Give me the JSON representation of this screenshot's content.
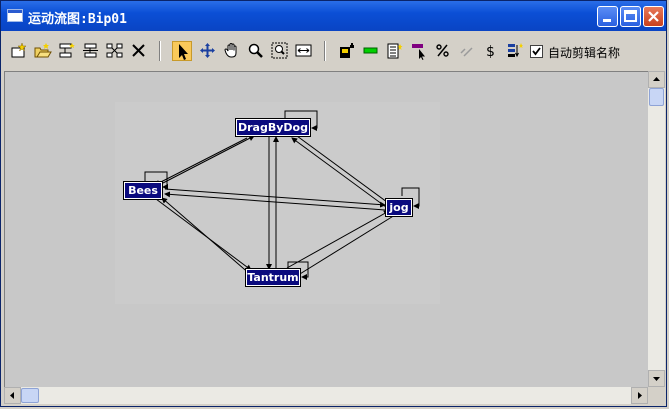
{
  "window": {
    "title": "运动流图:Bip01"
  },
  "toolbar": {
    "tools": [
      {
        "name": "new-motion-icon"
      },
      {
        "name": "open-file-icon"
      },
      {
        "name": "insert-transition-icon"
      },
      {
        "name": "edit-transition-icon"
      },
      {
        "name": "create-clip-icon"
      },
      {
        "name": "delete-icon"
      },
      {
        "name": "select-arrow-icon"
      },
      {
        "name": "move-icon"
      },
      {
        "name": "pan-hand-icon"
      },
      {
        "name": "zoom-icon"
      },
      {
        "name": "zoom-region-icon"
      },
      {
        "name": "fit-width-icon"
      },
      {
        "name": "save-script-icon"
      },
      {
        "name": "green-bar-icon"
      },
      {
        "name": "list-icon"
      },
      {
        "name": "flag-pointer-icon"
      },
      {
        "name": "percent-icon"
      },
      {
        "name": "link-icon"
      },
      {
        "name": "dollar-icon"
      },
      {
        "name": "sort-icon"
      }
    ],
    "auto_clip_names": {
      "label": "自动剪辑名称",
      "checked": true
    }
  },
  "graph": {
    "nodes": [
      {
        "id": "dragbydog",
        "label": "DragByDog"
      },
      {
        "id": "bees",
        "label": "Bees"
      },
      {
        "id": "jog",
        "label": "jog"
      },
      {
        "id": "tantrum",
        "label": "Tantrum"
      }
    ]
  }
}
